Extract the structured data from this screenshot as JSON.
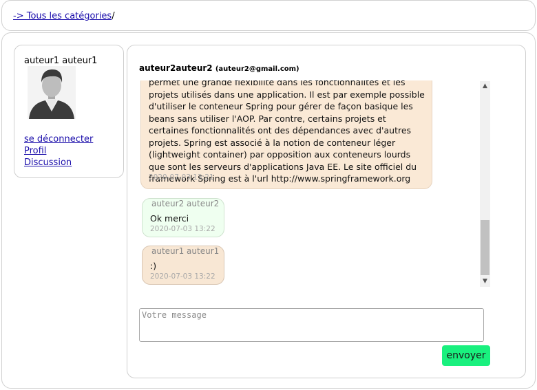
{
  "breadcrumb": {
    "link_label": "-> Tous les catégories",
    "separator": "/"
  },
  "user": {
    "name": "auteur1 auteur1",
    "links": [
      "se déconnecter",
      "Profil",
      "Discussion"
    ]
  },
  "chat": {
    "contact_name": "auteur2auteur2",
    "contact_email": "(auteur2@gmail.com)",
    "messages": [
      {
        "author": "",
        "text": "permet une grande flexibilité dans les fonctionnalités et les projets utilisés dans une application. Il est par exemple possible d'utiliser le conteneur Spring pour gérer de façon basique les beans sans utiliser l'AOP. Par contre, certains projets et certaines fonctionnalités ont des dépendances avec d'autres projets. Spring est associé à la notion de conteneur léger (lightweight container) par opposition aux conteneurs lourds que sont les serveurs d'applications Java EE. Le site officiel du framework Spring est à l'url http://www.springframework.org",
        "time": "2020-07-03 13:21"
      },
      {
        "author": "auteur2 auteur2",
        "text": "Ok merci",
        "time": "2020-07-03 13:22"
      },
      {
        "author": "auteur1 auteur1",
        "text": ":)",
        "time": "2020-07-03 13:22"
      }
    ],
    "input_placeholder": "Votre message",
    "send_label": "envoyer"
  },
  "colors": {
    "own_bubble": "#fae9d6",
    "other_bubble": "#effff0",
    "send_button": "#19f07e"
  }
}
